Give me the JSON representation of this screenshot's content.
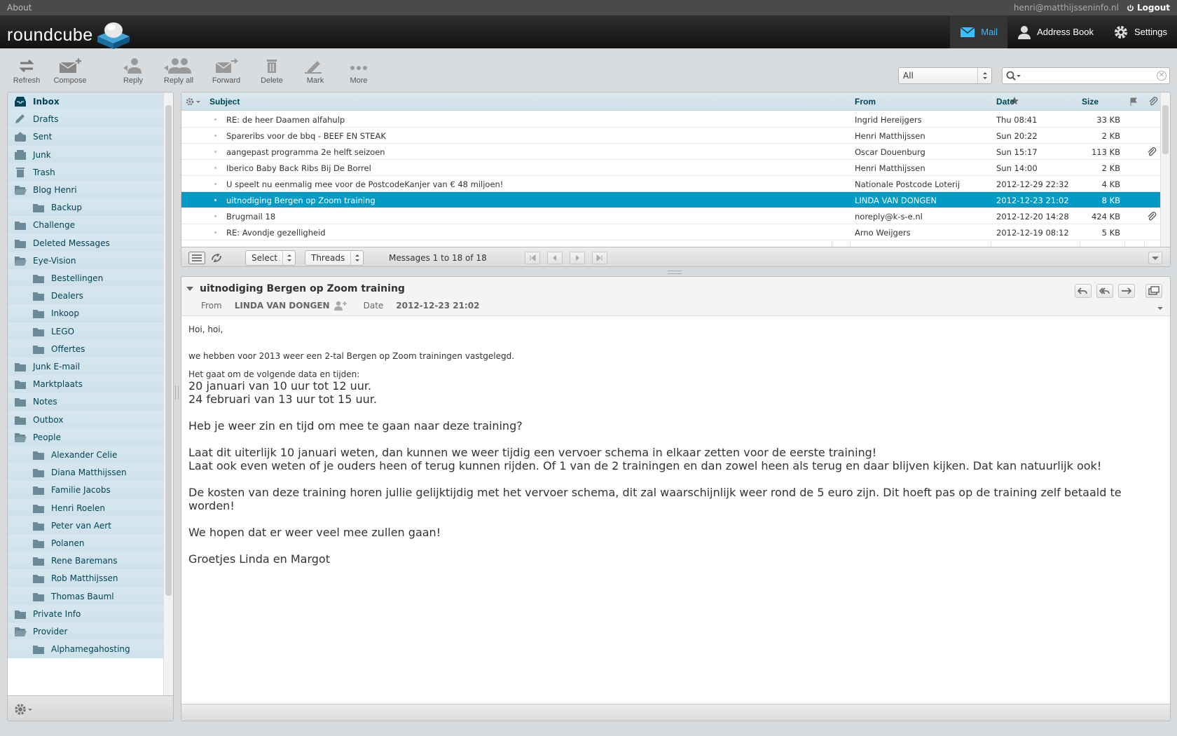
{
  "topline": {
    "about": "About",
    "user": "henri@matthijsseninfo.nl",
    "logout": "Logout"
  },
  "logo": {
    "text": "roundcube"
  },
  "tasks": {
    "mail": "Mail",
    "addressbook": "Address Book",
    "settings": "Settings"
  },
  "toolbar": {
    "refresh": "Refresh",
    "compose": "Compose",
    "reply": "Reply",
    "replyall": "Reply all",
    "forward": "Forward",
    "delete": "Delete",
    "mark": "Mark",
    "more": "More"
  },
  "filter": {
    "value": "All"
  },
  "folders": [
    {
      "label": "Inbox",
      "icon": "inbox-icon"
    },
    {
      "label": "Drafts",
      "icon": "pencil-icon"
    },
    {
      "label": "Sent",
      "icon": "sent-icon"
    },
    {
      "label": "Junk",
      "icon": "junk-icon"
    },
    {
      "label": "Trash",
      "icon": "trash-icon"
    },
    {
      "label": "Blog Henri",
      "icon": "folder-open-icon"
    },
    {
      "label": "Backup",
      "icon": "folder-icon"
    },
    {
      "label": "Challenge",
      "icon": "folder-icon"
    },
    {
      "label": "Deleted Messages",
      "icon": "folder-icon"
    },
    {
      "label": "Eye-Vision",
      "icon": "folder-open-icon"
    },
    {
      "label": "Bestellingen",
      "icon": "folder-icon"
    },
    {
      "label": "Dealers",
      "icon": "folder-icon"
    },
    {
      "label": "Inkoop",
      "icon": "folder-icon"
    },
    {
      "label": "LEGO",
      "icon": "folder-icon"
    },
    {
      "label": "Offertes",
      "icon": "folder-icon"
    },
    {
      "label": "Junk E-mail",
      "icon": "folder-icon"
    },
    {
      "label": "Marktplaats",
      "icon": "folder-icon"
    },
    {
      "label": "Notes",
      "icon": "folder-icon"
    },
    {
      "label": "Outbox",
      "icon": "folder-icon"
    },
    {
      "label": "People",
      "icon": "folder-open-icon"
    },
    {
      "label": "Alexander Celie",
      "icon": "folder-icon"
    },
    {
      "label": "Diana Matthijssen",
      "icon": "folder-icon"
    },
    {
      "label": "Familie Jacobs",
      "icon": "folder-icon"
    },
    {
      "label": "Henri Roelen",
      "icon": "folder-icon"
    },
    {
      "label": "Peter van Aert",
      "icon": "folder-icon"
    },
    {
      "label": "Polanen",
      "icon": "folder-icon"
    },
    {
      "label": "Rene Baremans",
      "icon": "folder-icon"
    },
    {
      "label": "Rob Matthijssen",
      "icon": "folder-icon"
    },
    {
      "label": "Thomas Bauml",
      "icon": "folder-icon"
    },
    {
      "label": "Private Info",
      "icon": "folder-icon"
    },
    {
      "label": "Provider",
      "icon": "folder-open-icon"
    },
    {
      "label": "Alphamegahosting",
      "icon": "folder-icon"
    }
  ],
  "list": {
    "headers": {
      "subject": "Subject",
      "from": "From",
      "date": "Date",
      "size": "Size"
    },
    "rows": [
      {
        "subject": "RE: de heer Daamen alfahulp",
        "from": "Ingrid Hereijgers",
        "date": "Thu 08:41",
        "size": "33 KB"
      },
      {
        "subject": "Spareribs voor de bbq - BEEF EN STEAK",
        "from": "Henri Matthijssen",
        "date": "Sun 20:22",
        "size": "2 KB"
      },
      {
        "subject": "aangepast programma 2e helft seizoen",
        "from": "Oscar Douenburg",
        "date": "Sun 15:17",
        "size": "113 KB"
      },
      {
        "subject": "Iberico Baby Back Ribs Bij De Borrel",
        "from": "Henri Matthijssen",
        "date": "Sun 14:00",
        "size": "2 KB"
      },
      {
        "subject": "U speelt nu eenmalig mee voor de PostcodeKanjer van € 48 miljoen!",
        "from": "Nationale Postcode Loterij",
        "date": "2012-12-29 22:32",
        "size": "4 KB"
      },
      {
        "subject": "uitnodiging Bergen op Zoom training",
        "from": "LINDA VAN DONGEN",
        "date": "2012-12-23 21:02",
        "size": "8 KB"
      },
      {
        "subject": "Brugmail 18",
        "from": "noreply@k-s-e.nl",
        "date": "2012-12-20 14:28",
        "size": "424 KB"
      },
      {
        "subject": "RE: Avondje gezelligheid",
        "from": "Arno Weijgers",
        "date": "2012-12-19 08:12",
        "size": "5 KB"
      }
    ],
    "footer": {
      "select": "Select",
      "threads": "Threads",
      "count": "Messages 1 to 18 of 18"
    }
  },
  "preview": {
    "subject": "uitnodiging Bergen op Zoom training",
    "from_label": "From",
    "from": "LINDA VAN DONGEN",
    "date_label": "Date",
    "date": "2012-12-23 21:02",
    "body": {
      "p1": "Hoi, hoi,",
      "p2": "we hebben voor 2013 weer een 2-tal Bergen op Zoom trainingen vastgelegd.",
      "p3": "Het gaat om de volgende data en tijden:",
      "d1": "20 januari van 10 uur tot 12 uur.",
      "d2": "24 februari van 13 uur tot 15 uur.",
      "q": "Heb je weer zin en tijd om mee te gaan naar deze training?",
      "l1": "Laat dit uiterlijk 10 januari weten, dan kunnen we weer tijdig een vervoer schema in elkaar zetten voor de eerste training!",
      "l2": "Laat ook even weten of je ouders heen of terug kunnen rijden. Of 1 van de 2 trainingen en dan zowel heen als terug en daar blijven kijken. Dat kan natuurlijk ook!",
      "k": "De kosten van deze training horen jullie gelijktijdig met het vervoer schema, dit zal waarschijnlijk weer rond de 5 euro zijn. Dit hoeft pas op de training zelf betaald te worden!",
      "h": "We hopen dat er weer veel mee zullen gaan!",
      "g": "Groetjes Linda en Margot"
    }
  },
  "colors": {
    "accent": "#019bc6",
    "header_bg": "#1a1a1a",
    "active_task": "#37beff",
    "folder_bg": "#d2e4ee"
  }
}
